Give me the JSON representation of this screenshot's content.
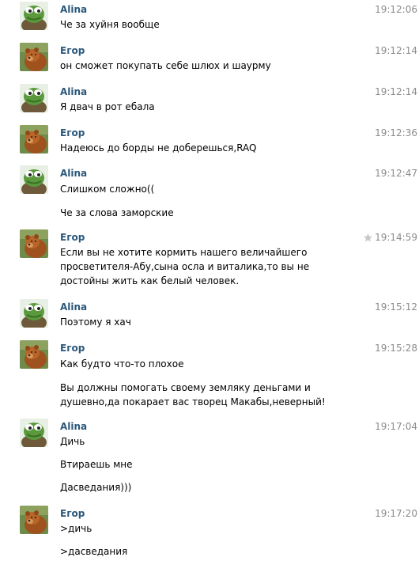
{
  "authors": {
    "alina": "Alina",
    "egor": "Егор"
  },
  "messages": [
    {
      "author": "Alina",
      "time": "19:12:06",
      "lines": [
        "Че за хуйня вообще"
      ]
    },
    {
      "author": "Егор",
      "time": "19:12:14",
      "lines": [
        "он сможет покупать себе шлюх и шаурму"
      ]
    },
    {
      "author": "Alina",
      "time": "19:12:14",
      "lines": [
        "Я двач в рот ебала"
      ]
    },
    {
      "author": "Егор",
      "time": "19:12:36",
      "lines": [
        "Надеюсь до борды не доберешься,RAQ"
      ]
    },
    {
      "author": "Alina",
      "time": "19:12:47",
      "lines": [
        "Слишком сложно((",
        "Че за слова заморские"
      ]
    },
    {
      "author": "Егор",
      "time": "19:14:59",
      "starred": true,
      "lines": [
        "Если вы не хотите кормить нашего величайшего просветителя-Абу,сына осла и виталика,то вы не достойны жить как белый человек."
      ]
    },
    {
      "author": "Alina",
      "time": "19:15:12",
      "lines": [
        "Поэтому я хач"
      ]
    },
    {
      "author": "Егор",
      "time": "19:15:28",
      "lines": [
        "Как будто что-то плохое",
        "Вы должны помогать своему земляку деньгами и душевно,да покарает вас творец Макабы,неверный!"
      ]
    },
    {
      "author": "Alina",
      "time": "19:17:04",
      "lines": [
        "Дичь",
        "Втираешь мне",
        "Дасведания)))"
      ]
    },
    {
      "author": "Егор",
      "time": "19:17:20",
      "lines": [
        ">дичь",
        ">дасведания"
      ]
    }
  ],
  "colors": {
    "author": "#2b587a",
    "time": "#8a8a8a",
    "star": "#c8c8c8"
  },
  "icons": {
    "alina_avatar": "frog-avatar-icon",
    "egor_avatar": "bear-avatar-icon",
    "favorite": "star-icon"
  }
}
